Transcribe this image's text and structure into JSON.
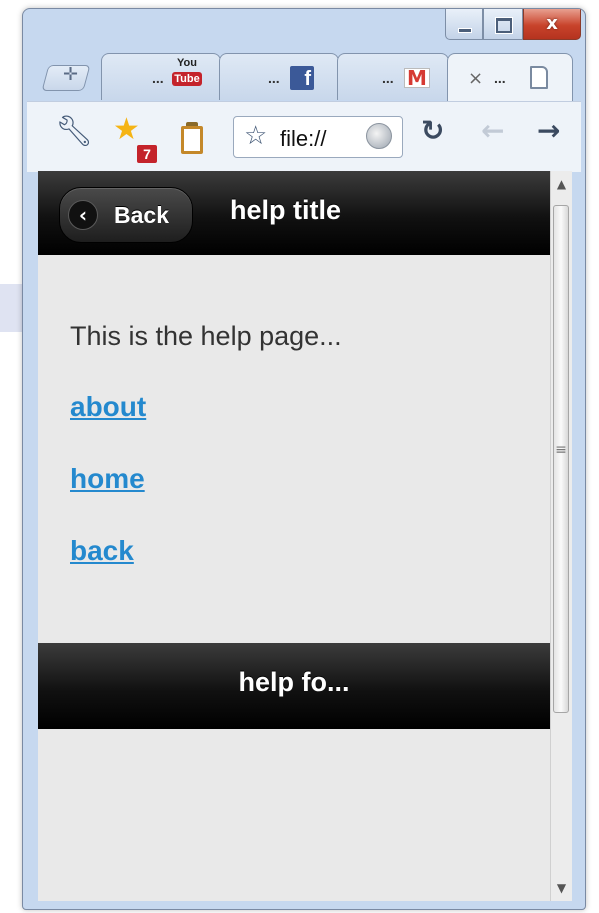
{
  "browser": {
    "caption": {
      "minimize_icon": "minimize-icon",
      "maximize_icon": "maximize-icon",
      "close_glyph": "x"
    },
    "new_tab_glyph": "✛",
    "tabs": [
      {
        "label": "...",
        "favicon": "youtube-icon",
        "favicon_top": "You",
        "favicon_bottom": "Tube"
      },
      {
        "label": "...",
        "favicon": "facebook-icon",
        "favicon_text": "f"
      },
      {
        "label": "...",
        "favicon": "gmail-icon",
        "favicon_text": "M"
      },
      {
        "label": "...",
        "favicon": "page-icon",
        "close_glyph": "×",
        "active": true
      }
    ],
    "toolbar": {
      "wrench_icon": "wrench-icon",
      "extension_badge": "7",
      "url": "file://",
      "reload_glyph": "↻",
      "back_glyph": "←",
      "forward_glyph": "→"
    }
  },
  "page": {
    "header": {
      "back_label": "Back",
      "back_glyph": "‹",
      "title": "help title"
    },
    "content": {
      "text": "This is the help page...",
      "links": [
        "about",
        "home",
        "back"
      ]
    },
    "footer": {
      "title": "help fo..."
    }
  },
  "scrollbar": {
    "up_glyph": "▲",
    "down_glyph": "▼",
    "grip_glyph": "≡"
  }
}
